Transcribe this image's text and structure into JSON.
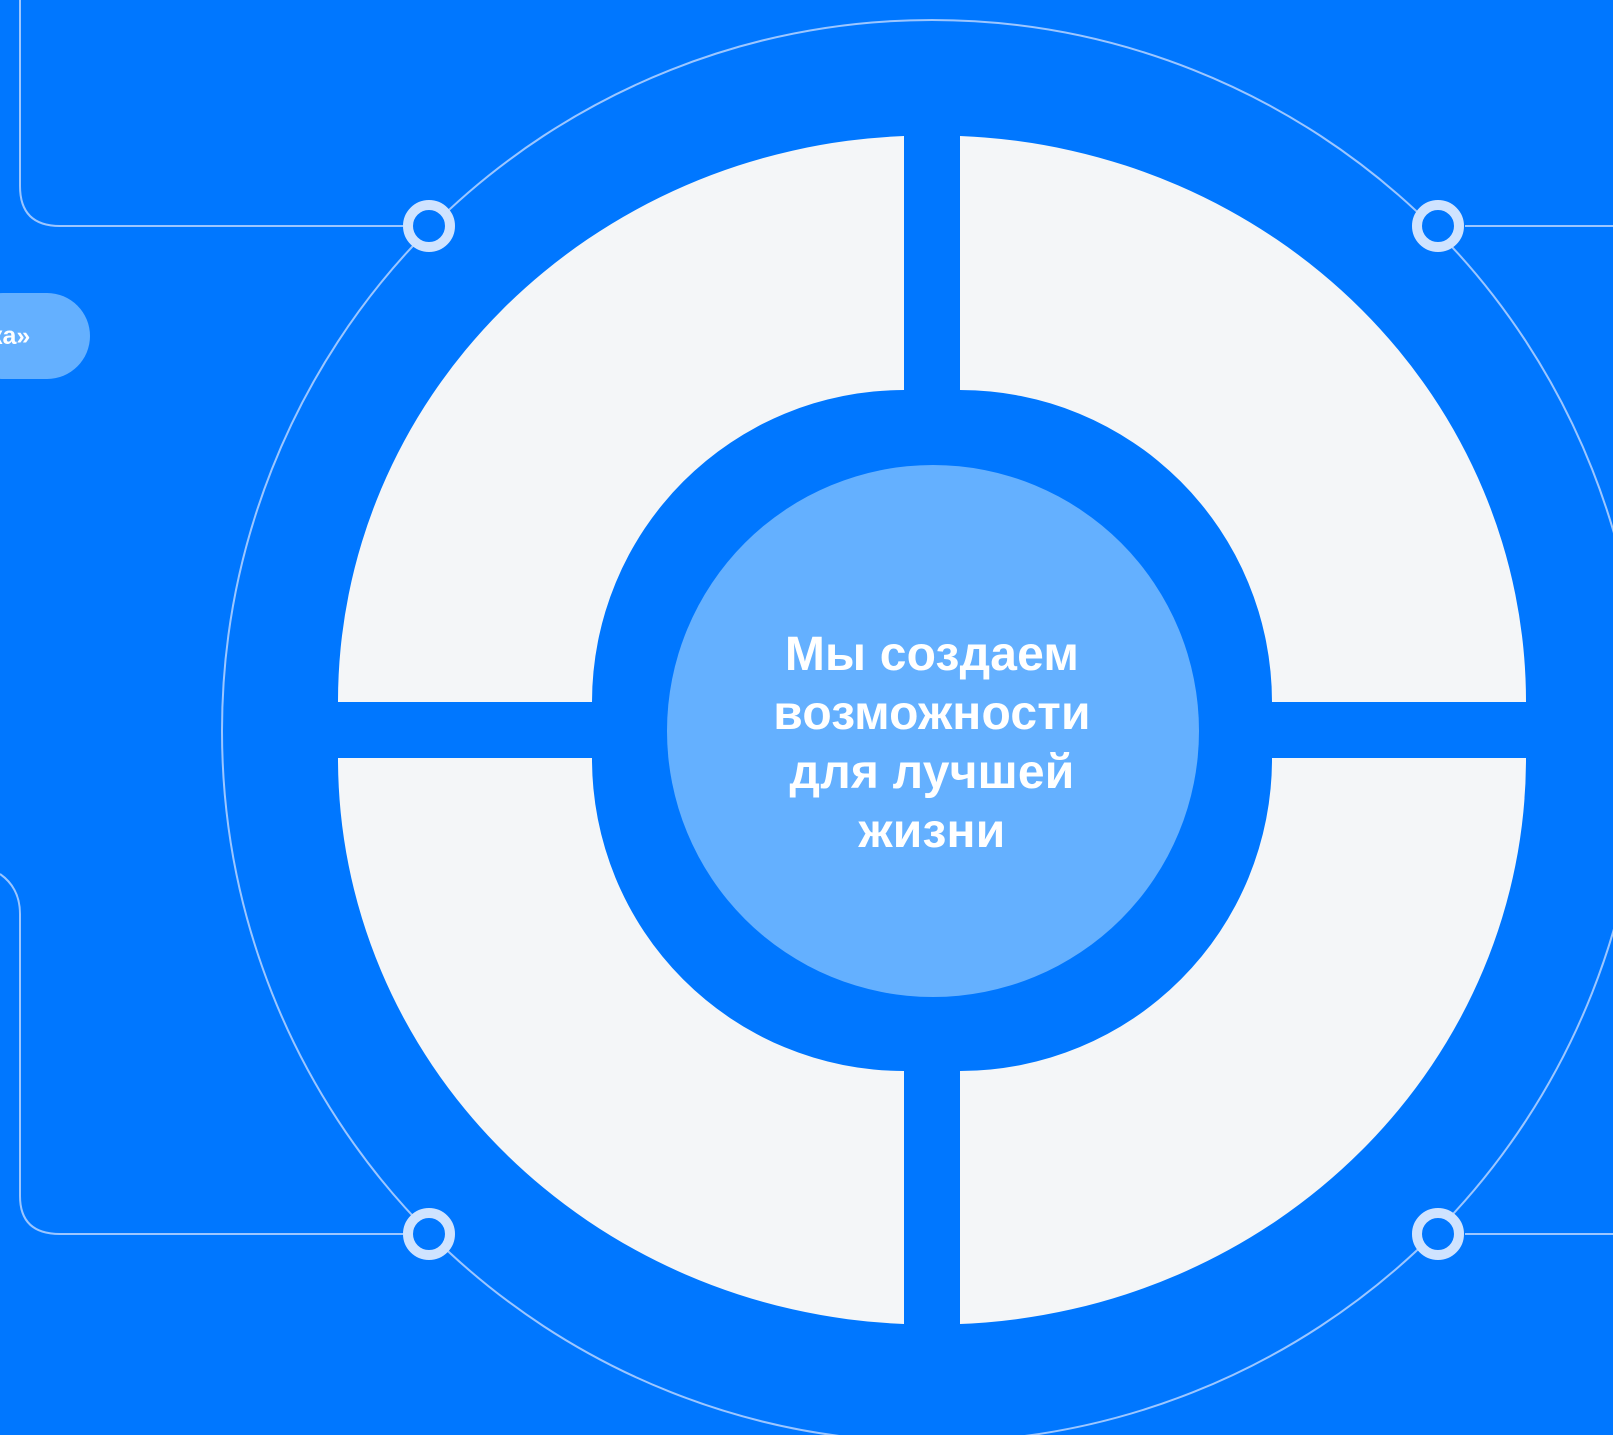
{
  "colors": {
    "background": "#0077FF",
    "segment_fill": "#F4F6F8",
    "hub_fill": "#64B0FF",
    "outline": "#9CC6FF",
    "node_ring": "#CFE3FF",
    "text": "#FFFFFF"
  },
  "side_tab": {
    "label": "ка»"
  },
  "center": {
    "lines": [
      "Мы создаем",
      "возможности",
      "для лучшей",
      "жизни"
    ]
  }
}
